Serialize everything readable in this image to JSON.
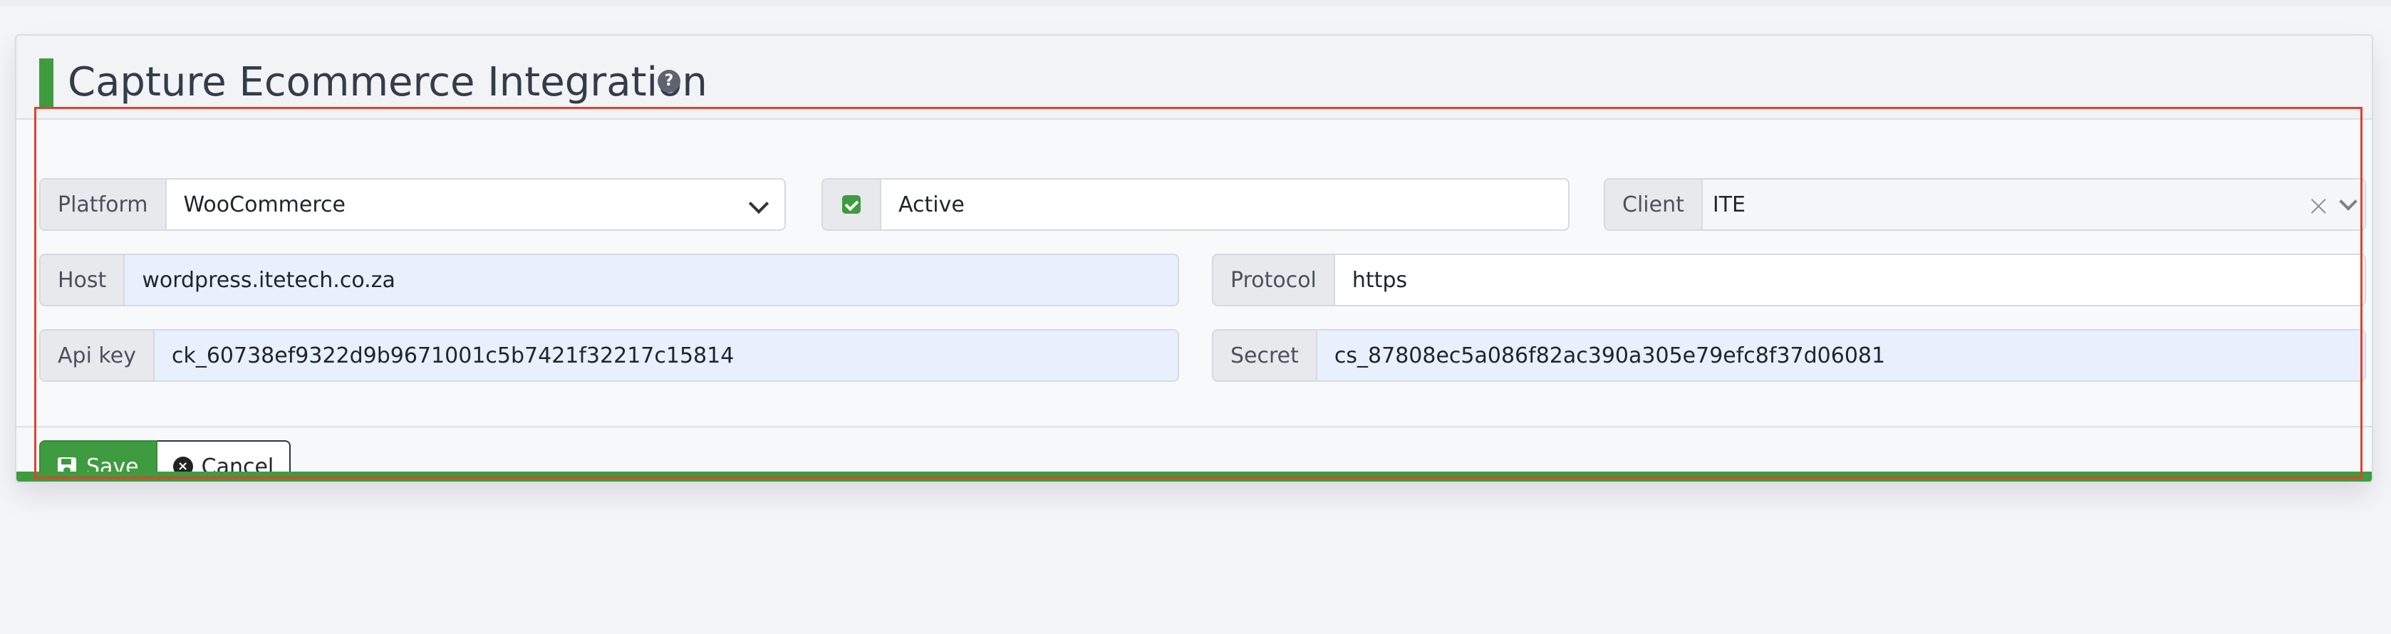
{
  "panel": {
    "title": "Capture Ecommerce Integration",
    "help_icon": "?"
  },
  "form": {
    "platform": {
      "label": "Platform",
      "value": "WooCommerce"
    },
    "active": {
      "label": "Active",
      "checked": true
    },
    "client": {
      "label": "Client",
      "value": "ITE"
    },
    "host": {
      "label": "Host",
      "value": "wordpress.itetech.co.za"
    },
    "protocol": {
      "label": "Protocol",
      "value": "https"
    },
    "api_key": {
      "label": "Api key",
      "value": "ck_60738ef9322d9b9671001c5b7421f32217c15814"
    },
    "secret": {
      "label": "Secret",
      "value": "cs_87808ec5a086f82ac390a305e79efc8f37d06081"
    }
  },
  "footer": {
    "save_label": "Save",
    "cancel_label": "Cancel"
  },
  "colors": {
    "accent": "#3f9b3f",
    "autofill": "#e8f0fe",
    "highlight": "#e2412e"
  },
  "icons": {
    "help": "question-circle-icon",
    "platform_dropdown": "chevron-down-icon",
    "active_check": "checkbox-checked-icon",
    "client_clear": "close-icon",
    "client_dropdown": "chevron-down-icon",
    "save": "floppy-disk-icon",
    "cancel": "x-circle-icon"
  }
}
